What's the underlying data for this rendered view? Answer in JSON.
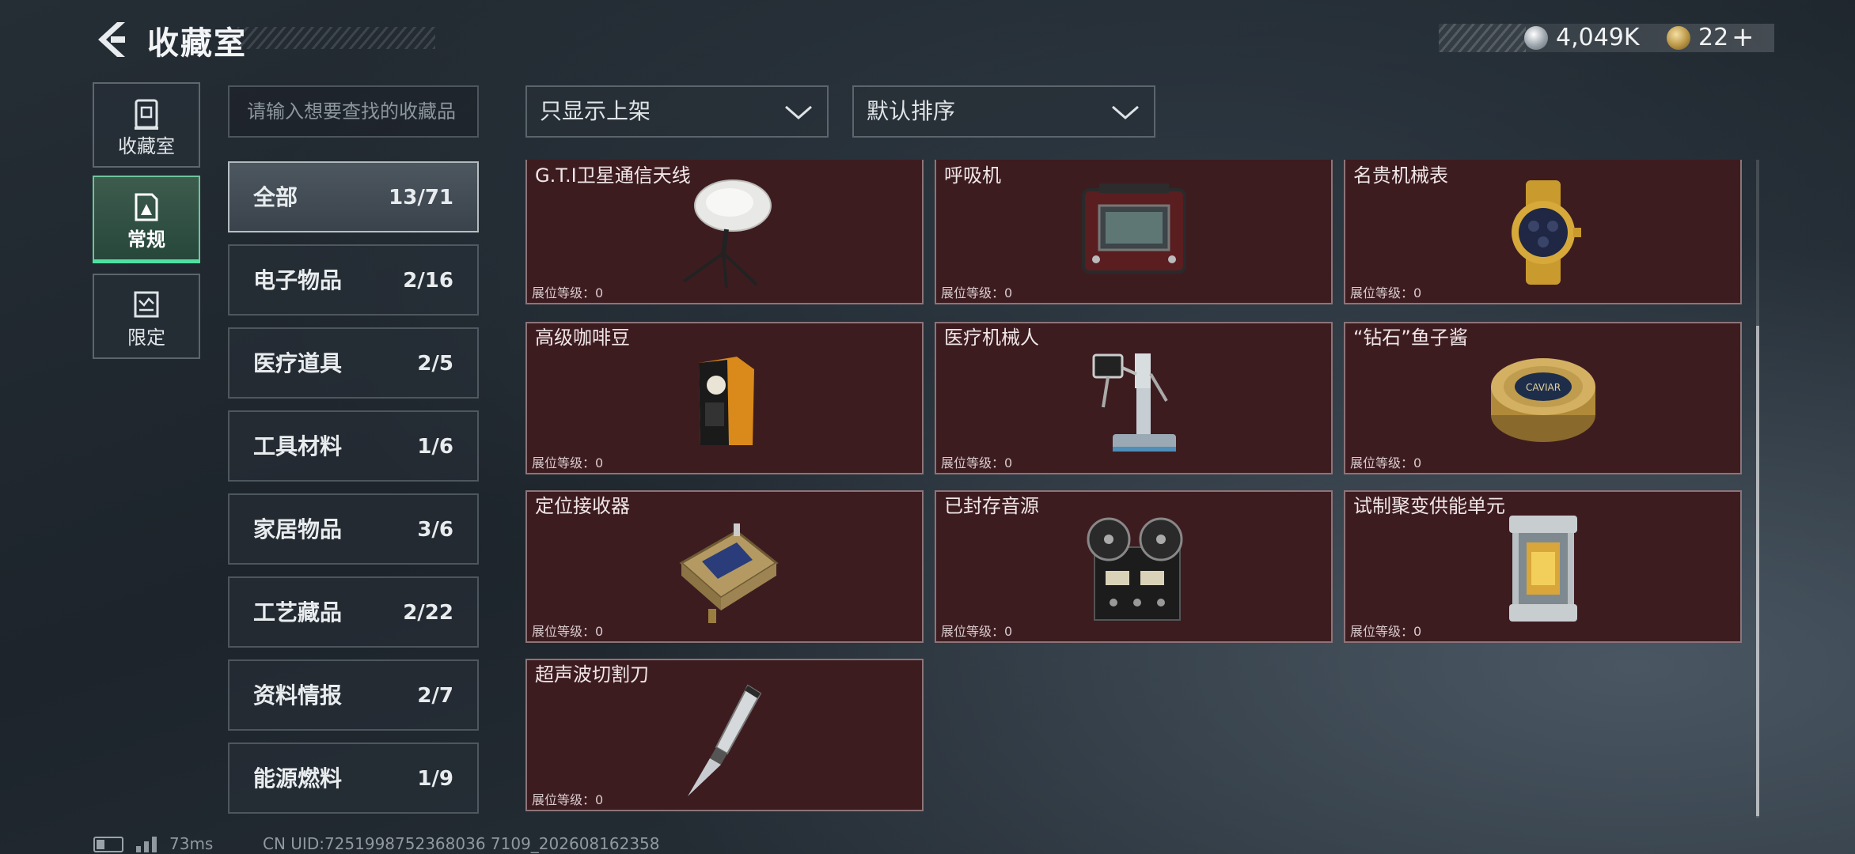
{
  "header": {
    "title": "收藏室",
    "silver_amount": "4,049K",
    "gold_amount": "22",
    "gold_plus": "+",
    "icons": {
      "back": "back-arrow-icon",
      "silver": "silver-coin-icon",
      "gold": "gold-coin-icon"
    }
  },
  "side_tabs": [
    {
      "label": "收藏室",
      "icon": "vault-icon",
      "active": false
    },
    {
      "label": "常规",
      "icon": "normal-collection-icon",
      "active": true
    },
    {
      "label": "限定",
      "icon": "limited-collection-icon",
      "active": false
    }
  ],
  "search": {
    "placeholder": "请输入想要查找的收藏品"
  },
  "filters": {
    "display_filter": "只显示上架",
    "sort": "默认排序"
  },
  "categories": [
    {
      "name": "全部",
      "count": "13/71",
      "active": true
    },
    {
      "name": "电子物品",
      "count": "2/16"
    },
    {
      "name": "医疗道具",
      "count": "2/5"
    },
    {
      "name": "工具材料",
      "count": "1/6"
    },
    {
      "name": "家居物品",
      "count": "3/6"
    },
    {
      "name": "工艺藏品",
      "count": "2/22"
    },
    {
      "name": "资料情报",
      "count": "2/7"
    },
    {
      "name": "能源燃料",
      "count": "1/9"
    }
  ],
  "items": [
    {
      "name": "G.T.I卫星通信天线",
      "level": "展位等级：0",
      "icon": "satellite-antenna-icon"
    },
    {
      "name": "呼吸机",
      "level": "展位等级：0",
      "icon": "ventilator-icon"
    },
    {
      "name": "名贵机械表",
      "level": "展位等级：0",
      "icon": "luxury-watch-icon"
    },
    {
      "name": "高级咖啡豆",
      "level": "展位等级：0",
      "icon": "coffee-bag-icon"
    },
    {
      "name": "医疗机械人",
      "level": "展位等级：0",
      "icon": "medical-robot-icon"
    },
    {
      "name": "“钻石”鱼子酱",
      "level": "展位等级：0",
      "icon": "caviar-tin-icon"
    },
    {
      "name": "定位接收器",
      "level": "展位等级：0",
      "icon": "gps-receiver-icon"
    },
    {
      "name": "已封存音源",
      "level": "展位等级：0",
      "icon": "reel-recorder-icon"
    },
    {
      "name": "试制聚变供能单元",
      "level": "展位等级：0",
      "icon": "fusion-cell-icon"
    },
    {
      "name": "超声波切割刀",
      "level": "展位等级：0",
      "icon": "ultrasonic-knife-icon"
    }
  ],
  "caviar_label": "CAVIAR",
  "footer": {
    "ping": "73ms",
    "uid": "CN UID:7251998752368036 7109_202608162358"
  },
  "colors": {
    "card_bg": "#3d1c20",
    "active_tab_accent": "#4fe0a0"
  }
}
